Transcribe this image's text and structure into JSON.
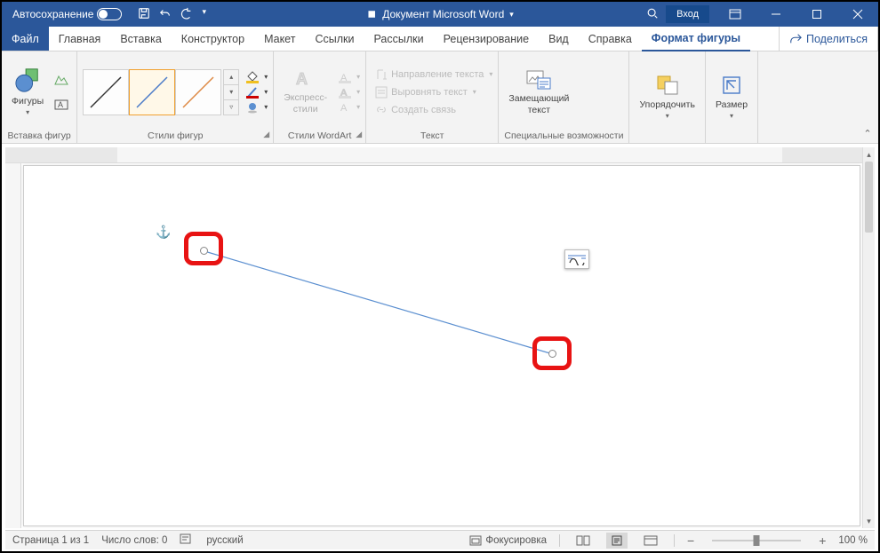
{
  "titlebar": {
    "autosave": "Автосохранение",
    "doc_title": "Документ Microsoft Word",
    "signin": "Вход"
  },
  "tabs": {
    "file": "Файл",
    "home": "Главная",
    "insert": "Вставка",
    "design": "Конструктор",
    "layout": "Макет",
    "references": "Ссылки",
    "mailings": "Рассылки",
    "review": "Рецензирование",
    "view": "Вид",
    "help": "Справка",
    "shape_format": "Формат фигуры",
    "share": "Поделиться"
  },
  "ribbon": {
    "insert_shapes": {
      "shapes": "Фигуры",
      "label": "Вставка фигур"
    },
    "shape_styles": {
      "label": "Стили фигур",
      "fill": "Заливка",
      "outline": "Контур",
      "effects": "Эффекты"
    },
    "wordart": {
      "express": "Экспресс-\nстили",
      "label": "Стили WordArt"
    },
    "text": {
      "label": "Текст",
      "direction": "Направление текста",
      "align": "Выровнять текст",
      "link": "Создать связь"
    },
    "accessibility": {
      "alt_text": "Замещающий\nтекст",
      "label": "Специальные возможности"
    },
    "arrange": {
      "arrange": "Упорядочить",
      "label": ""
    },
    "size": {
      "size": "Размер",
      "label": ""
    }
  },
  "status": {
    "page": "Страница 1 из 1",
    "words": "Число слов: 0",
    "language": "русский",
    "focus": "Фокусировка",
    "zoom": "100 %"
  }
}
